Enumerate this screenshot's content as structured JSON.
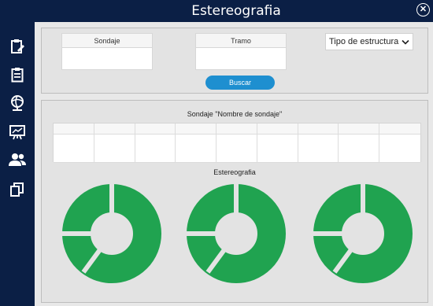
{
  "window": {
    "title": "Estereografia"
  },
  "icons": {
    "menu": "hamburger-menu-icon",
    "close": "close-circle-icon",
    "sidebar": [
      "clipboard-edit-icon",
      "clipboard-list-icon",
      "globe-icon",
      "presentation-icon",
      "users-icon",
      "copy-icon"
    ]
  },
  "filters": {
    "sondaje_label": "Sondaje",
    "tramo_label": "Tramo",
    "estructura_select": "Tipo de estructura",
    "search_label": "Buscar"
  },
  "results": {
    "title": "Sondaje \"Nombre de sondaje\"",
    "section_label": "Estereografia"
  },
  "colors": {
    "navy": "#0b1f45",
    "accent": "#1e8fd0",
    "donut": "#20a350"
  }
}
